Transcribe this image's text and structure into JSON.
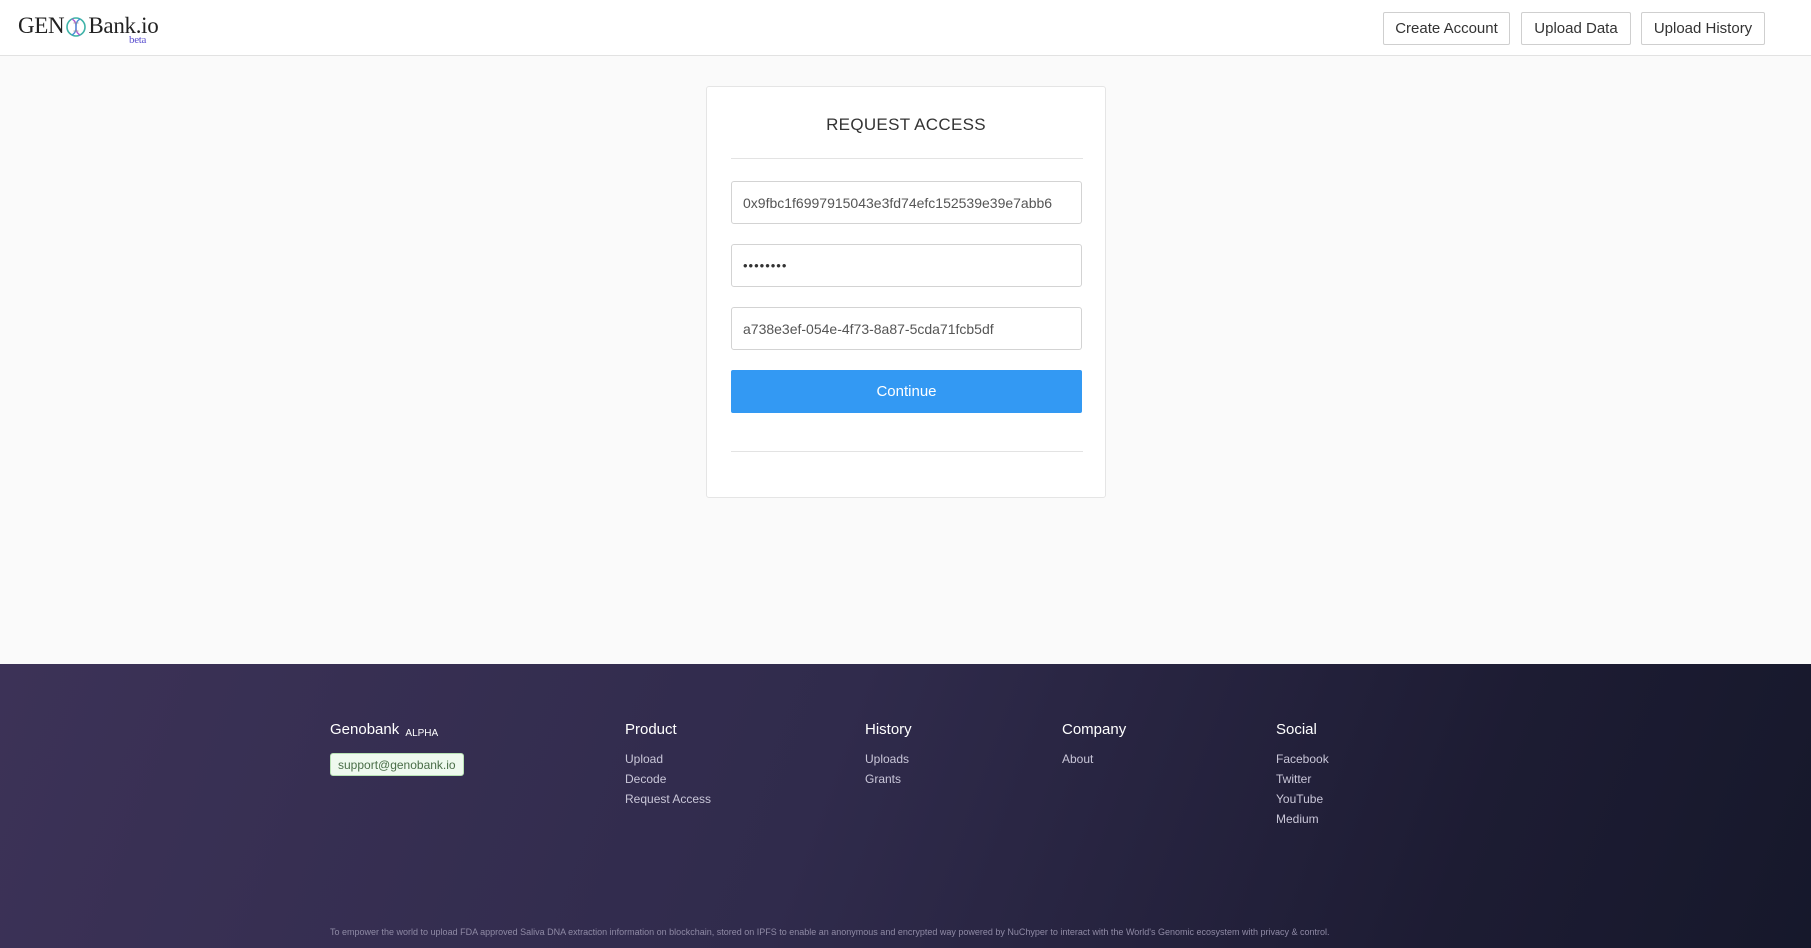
{
  "header": {
    "logo_text_left": "GEN",
    "logo_text_right": "Bank.io",
    "logo_badge": "beta",
    "nav": {
      "create_account": "Create Account",
      "upload_data": "Upload Data",
      "upload_history": "Upload History"
    }
  },
  "card": {
    "title": "REQUEST ACCESS",
    "address_value": "0x9fbc1f6997915043e3fd74efc152539e39e7abb6",
    "password_value": "••••••••",
    "key_value": "a738e3ef-054e-4f73-8a87-5cda71fcb5df",
    "continue_label": "Continue"
  },
  "footer": {
    "brand": "Genobank",
    "brand_badge": "ALPHA",
    "support_email": "support@genobank.io",
    "columns": [
      {
        "title": "Product",
        "links": [
          "Upload",
          "Decode",
          "Request Access"
        ]
      },
      {
        "title": "History",
        "links": [
          "Uploads",
          "Grants"
        ]
      },
      {
        "title": "Company",
        "links": [
          "About"
        ]
      },
      {
        "title": "Social",
        "links": [
          "Facebook",
          "Twitter",
          "YouTube",
          "Medium"
        ]
      }
    ],
    "tagline": "To empower the world to upload FDA approved Saliva DNA extraction information on blockchain, stored on IPFS to enable an anonymous and encrypted way powered by NuChyper to interact with the World's Genomic ecosystem with privacy & control."
  },
  "colors": {
    "primary_button": "#3399f3",
    "footer_dark": "#302b4c",
    "logo_accent": "#5a4fcf"
  },
  "icons": [
    "dna-logo-icon"
  ]
}
